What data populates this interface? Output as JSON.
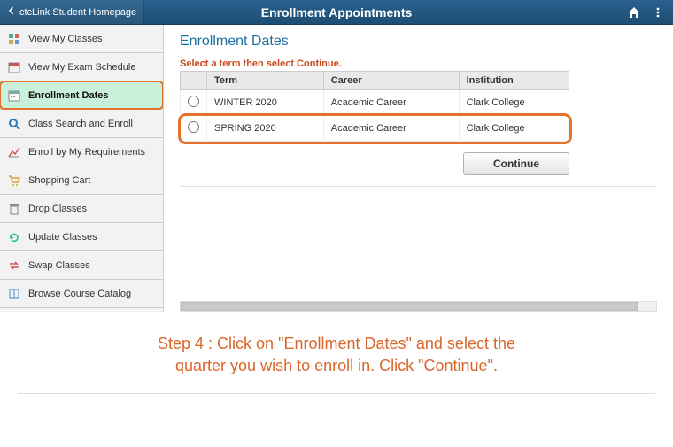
{
  "topbar": {
    "back_label": "ctcLink Student Homepage",
    "title": "Enrollment Appointments"
  },
  "sidebar": {
    "items": [
      {
        "label": "View My Classes"
      },
      {
        "label": "View My Exam Schedule"
      },
      {
        "label": "Enrollment Dates",
        "active": true
      },
      {
        "label": "Class Search and Enroll"
      },
      {
        "label": "Enroll by My Requirements"
      },
      {
        "label": "Shopping Cart"
      },
      {
        "label": "Drop Classes"
      },
      {
        "label": "Update Classes"
      },
      {
        "label": "Swap Classes"
      },
      {
        "label": "Browse Course Catalog"
      }
    ]
  },
  "main": {
    "title": "Enrollment Dates",
    "instruction": "Select a term then select Continue.",
    "columns": {
      "term": "Term",
      "career": "Career",
      "institution": "Institution"
    },
    "rows": [
      {
        "term": "WINTER 2020",
        "career": "Academic Career",
        "institution": "Clark College"
      },
      {
        "term": "SPRING 2020",
        "career": "Academic Career",
        "institution": "Clark College",
        "highlight": true
      }
    ],
    "continue_label": "Continue"
  },
  "caption": {
    "line1": "Step 4 : Click on \"Enrollment Dates\" and select the",
    "line2": "quarter you wish to enroll in. Click \"Continue\"."
  }
}
